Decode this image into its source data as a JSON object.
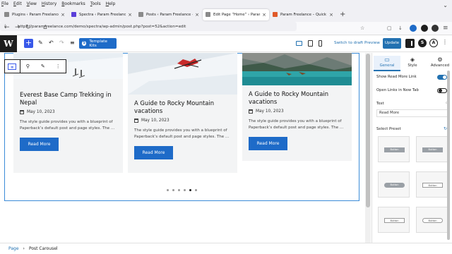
{
  "menubar": [
    "File",
    "Edit",
    "View",
    "History",
    "Bookmarks",
    "Tools",
    "Help"
  ],
  "tabs": [
    {
      "title": "Plugins ‹ Param Freelance — W",
      "fav": "#8a8a8a",
      "active": false
    },
    {
      "title": "Spectra ‹ Param Freelance — W",
      "fav": "#5b3fd9",
      "active": false
    },
    {
      "title": "Posts ‹ Param Freelance — Wor",
      "fav": "#8a8a8a",
      "active": false
    },
    {
      "title": "Edit Page “Home” ‹ Param Free",
      "fav": "#8a8a8a",
      "active": true
    },
    {
      "title": "Param Freelance – Quick Tips!",
      "fav": "#e05a2a",
      "active": false
    }
  ],
  "url": "https://paramfreelance.com/demo/spectra/wp-admin/post.php?post=52&action=edit",
  "toolbar": {
    "template_kits": "Template Kits",
    "switch_to_draft": "Switch to draft",
    "preview": "Preview",
    "update": "Update"
  },
  "cards": [
    {
      "title": "Everest Base Camp Trekking in Nepal",
      "date": "May 10, 2023",
      "excerpt": "The style guide provides you with a blueprint of Paperback’s default post and page styles. The …",
      "button": "Read More"
    },
    {
      "title": "A Guide to Rocky Mountain vacations",
      "date": "May 10, 2023",
      "excerpt": "The style guide provides you with a blueprint of Paperback’s default post and page styles. The …",
      "button": "Read More"
    },
    {
      "title": "A Guide to Rocky Mountain vacations",
      "date": "May 10, 2023",
      "excerpt": "The style guide provides you with a blueprint of Paperback’s default post and page styles. The …",
      "button": "Read More"
    }
  ],
  "carousel": {
    "dot_count": 6,
    "active_dot": 4
  },
  "inspector": {
    "tabs": [
      "General",
      "Style",
      "Advanced"
    ],
    "show_read_more_label": "Show Read More Link",
    "show_read_more_on": true,
    "open_new_tab_label": "Open Links in New Tab",
    "open_new_tab_on": false,
    "text_label": "Text",
    "text_value": "Read More",
    "select_preset_label": "Select Preset",
    "preset_button_text": "Button"
  },
  "breadcrumb": {
    "root": "Page",
    "current": "Post Carousel"
  },
  "colors": {
    "wp_blue": "#2271b1",
    "read_more": "#1e6bc8",
    "accent": "#3858e9"
  }
}
